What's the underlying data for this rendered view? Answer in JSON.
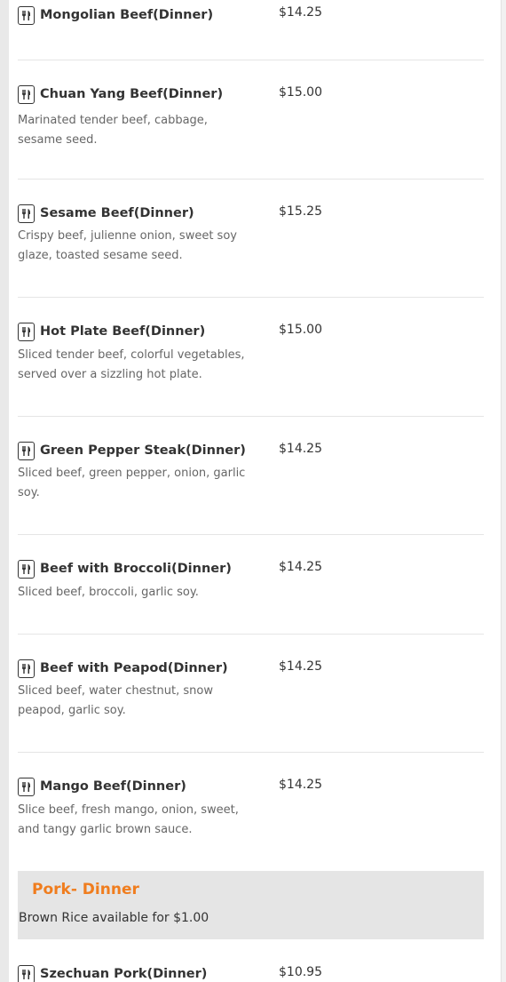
{
  "menu": {
    "items": [
      {
        "name": "Mongolian Beef(Dinner)",
        "price": "$14.25",
        "description": ""
      },
      {
        "name": "Chuan Yang Beef(Dinner)",
        "price": "$15.00",
        "description": "Marinated tender beef, cabbage, sesame seed."
      },
      {
        "name": "Sesame Beef(Dinner)",
        "price": "$15.25",
        "description": "Crispy beef, julienne onion, sweet soy glaze, toasted sesame seed."
      },
      {
        "name": "Hot Plate Beef(Dinner)",
        "price": "$15.00",
        "description": "Sliced tender beef, colorful vegetables, served over a sizzling hot plate."
      },
      {
        "name": "Green Pepper Steak(Dinner)",
        "price": "$14.25",
        "description": "Sliced beef, green pepper, onion, garlic soy."
      },
      {
        "name": "Beef with Broccoli(Dinner)",
        "price": "$14.25",
        "description": "Sliced beef, broccoli, garlic soy."
      },
      {
        "name": "Beef with Peapod(Dinner)",
        "price": "$14.25",
        "description": "Sliced beef, water chestnut, snow peapod, garlic soy."
      },
      {
        "name": "Mango Beef(Dinner)",
        "price": "$14.25",
        "description": "Slice beef, fresh mango, onion, sweet, and tangy garlic brown sauce."
      }
    ],
    "section": {
      "title": "Pork- Dinner",
      "note": "Brown Rice available for $1.00"
    },
    "next_item": {
      "name": "Szechuan Pork(Dinner)",
      "price": "$10.95"
    }
  },
  "icons": {
    "item_icon": "utensils-icon"
  },
  "colors": {
    "section_title": "#f07d1e",
    "section_band": "#e5e5e5"
  }
}
